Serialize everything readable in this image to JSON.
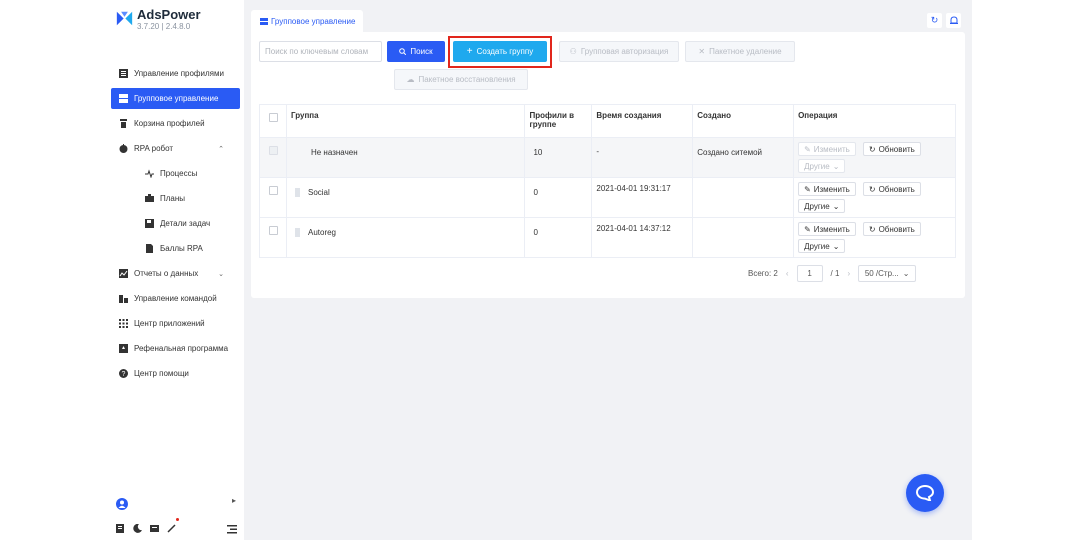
{
  "app": {
    "name": "AdsPower",
    "version": "3.7.20 | 2.4.8.0",
    "accent": "#2a5bf4"
  },
  "sidebar": {
    "items": [
      {
        "label": "Управление профилями",
        "icon": "profiles-icon",
        "active": false
      },
      {
        "label": "Групповое управление",
        "icon": "groups-icon",
        "active": true
      },
      {
        "label": "Корзина профилей",
        "icon": "trash-icon",
        "active": false
      },
      {
        "label": "RPA робот",
        "icon": "robot-icon",
        "active": false,
        "expand": "up"
      },
      {
        "label": "Процессы",
        "icon": "process-icon",
        "sub": true
      },
      {
        "label": "Планы",
        "icon": "briefcase-icon",
        "sub": true
      },
      {
        "label": "Детали задач",
        "icon": "save-icon",
        "sub": true
      },
      {
        "label": "Баллы RPA",
        "icon": "document-icon",
        "sub": true
      },
      {
        "label": "Отчеты о данных",
        "icon": "chart-icon",
        "active": false,
        "expand": "down"
      },
      {
        "label": "Управление командой",
        "icon": "team-icon",
        "active": false
      },
      {
        "label": "Центр приложений",
        "icon": "apps-grid-icon",
        "active": false
      },
      {
        "label": "Рефенальная программа",
        "icon": "referral-icon",
        "active": false
      },
      {
        "label": "Центр помощи",
        "icon": "help-icon",
        "active": false
      }
    ]
  },
  "tab": {
    "label": "Групповое управление"
  },
  "toolbar": {
    "search_placeholder": "Поиск по ключевым словам",
    "search_label": "Поиск",
    "create_label": "Создать группу",
    "auth_label": "Групповая авторизация",
    "delete_label": "Пакетное удаление",
    "restore_label": "Пакетное восстановления"
  },
  "table": {
    "headers": {
      "group": "Группа",
      "profiles": "Профили в группе",
      "created_time": "Время создания",
      "created_by": "Создано",
      "operation": "Операция"
    },
    "rows": [
      {
        "name": "Не назначен",
        "profiles": "10",
        "created_time": "-",
        "created_by": "Создано ситемой"
      },
      {
        "name": "Social",
        "profiles": "0",
        "created_time": "2021-04-01 19:31:17",
        "created_by": ""
      },
      {
        "name": "Autoreg",
        "profiles": "0",
        "created_time": "2021-04-01 14:37:12",
        "created_by": ""
      }
    ],
    "edit_label": "Изменить",
    "refresh_label": "Обновить",
    "other_label": "Другие"
  },
  "pagination": {
    "total": "Всего: 2",
    "current_page": "1",
    "of_pages": "/  1",
    "page_size": "50 /Стр..."
  }
}
